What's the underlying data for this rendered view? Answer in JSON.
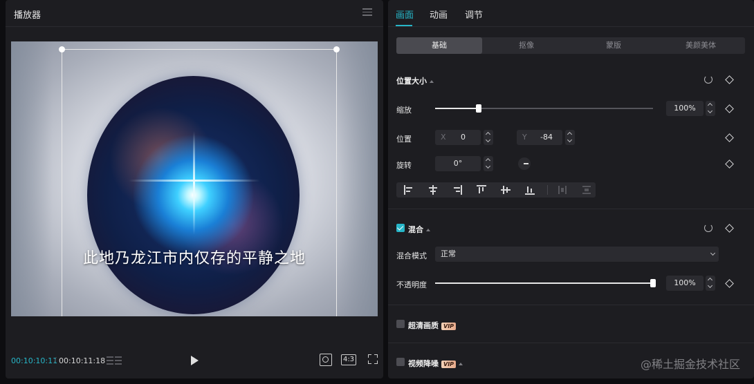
{
  "player": {
    "title": "播放器",
    "caption": "此地乃龙江市内仅存的平静之地",
    "current_time": "00:10:10:11",
    "time_separator": "/",
    "total_time": "00:10:11:18",
    "ratio_label": "4:3"
  },
  "inspector": {
    "top_tabs": [
      "画面",
      "动画",
      "调节"
    ],
    "sub_tabs": [
      "基础",
      "抠像",
      "蒙版",
      "美颜美体"
    ],
    "position_size": {
      "title": "位置大小",
      "scale_label": "缩放",
      "scale_value": "100%",
      "scale_fraction": 0.2,
      "position_label": "位置",
      "x_prefix": "X",
      "x_value": "0",
      "y_prefix": "Y",
      "y_value": "-84",
      "rotate_label": "旋转",
      "rotate_value": "0°"
    },
    "blend": {
      "title": "混合",
      "checked": true,
      "mode_label": "混合模式",
      "mode_value": "正常",
      "opacity_label": "不透明度",
      "opacity_value": "100%",
      "opacity_fraction": 1.0
    },
    "hd": {
      "label": "超清画质",
      "badge": "VIP",
      "checked": false
    },
    "denoise": {
      "label": "视频降噪",
      "badge": "VIP",
      "checked": false
    }
  },
  "watermark": "@稀土掘金技术社区",
  "colors": {
    "accent": "#27b6c8",
    "panel": "#1d1d21",
    "field": "#2b2b30"
  }
}
